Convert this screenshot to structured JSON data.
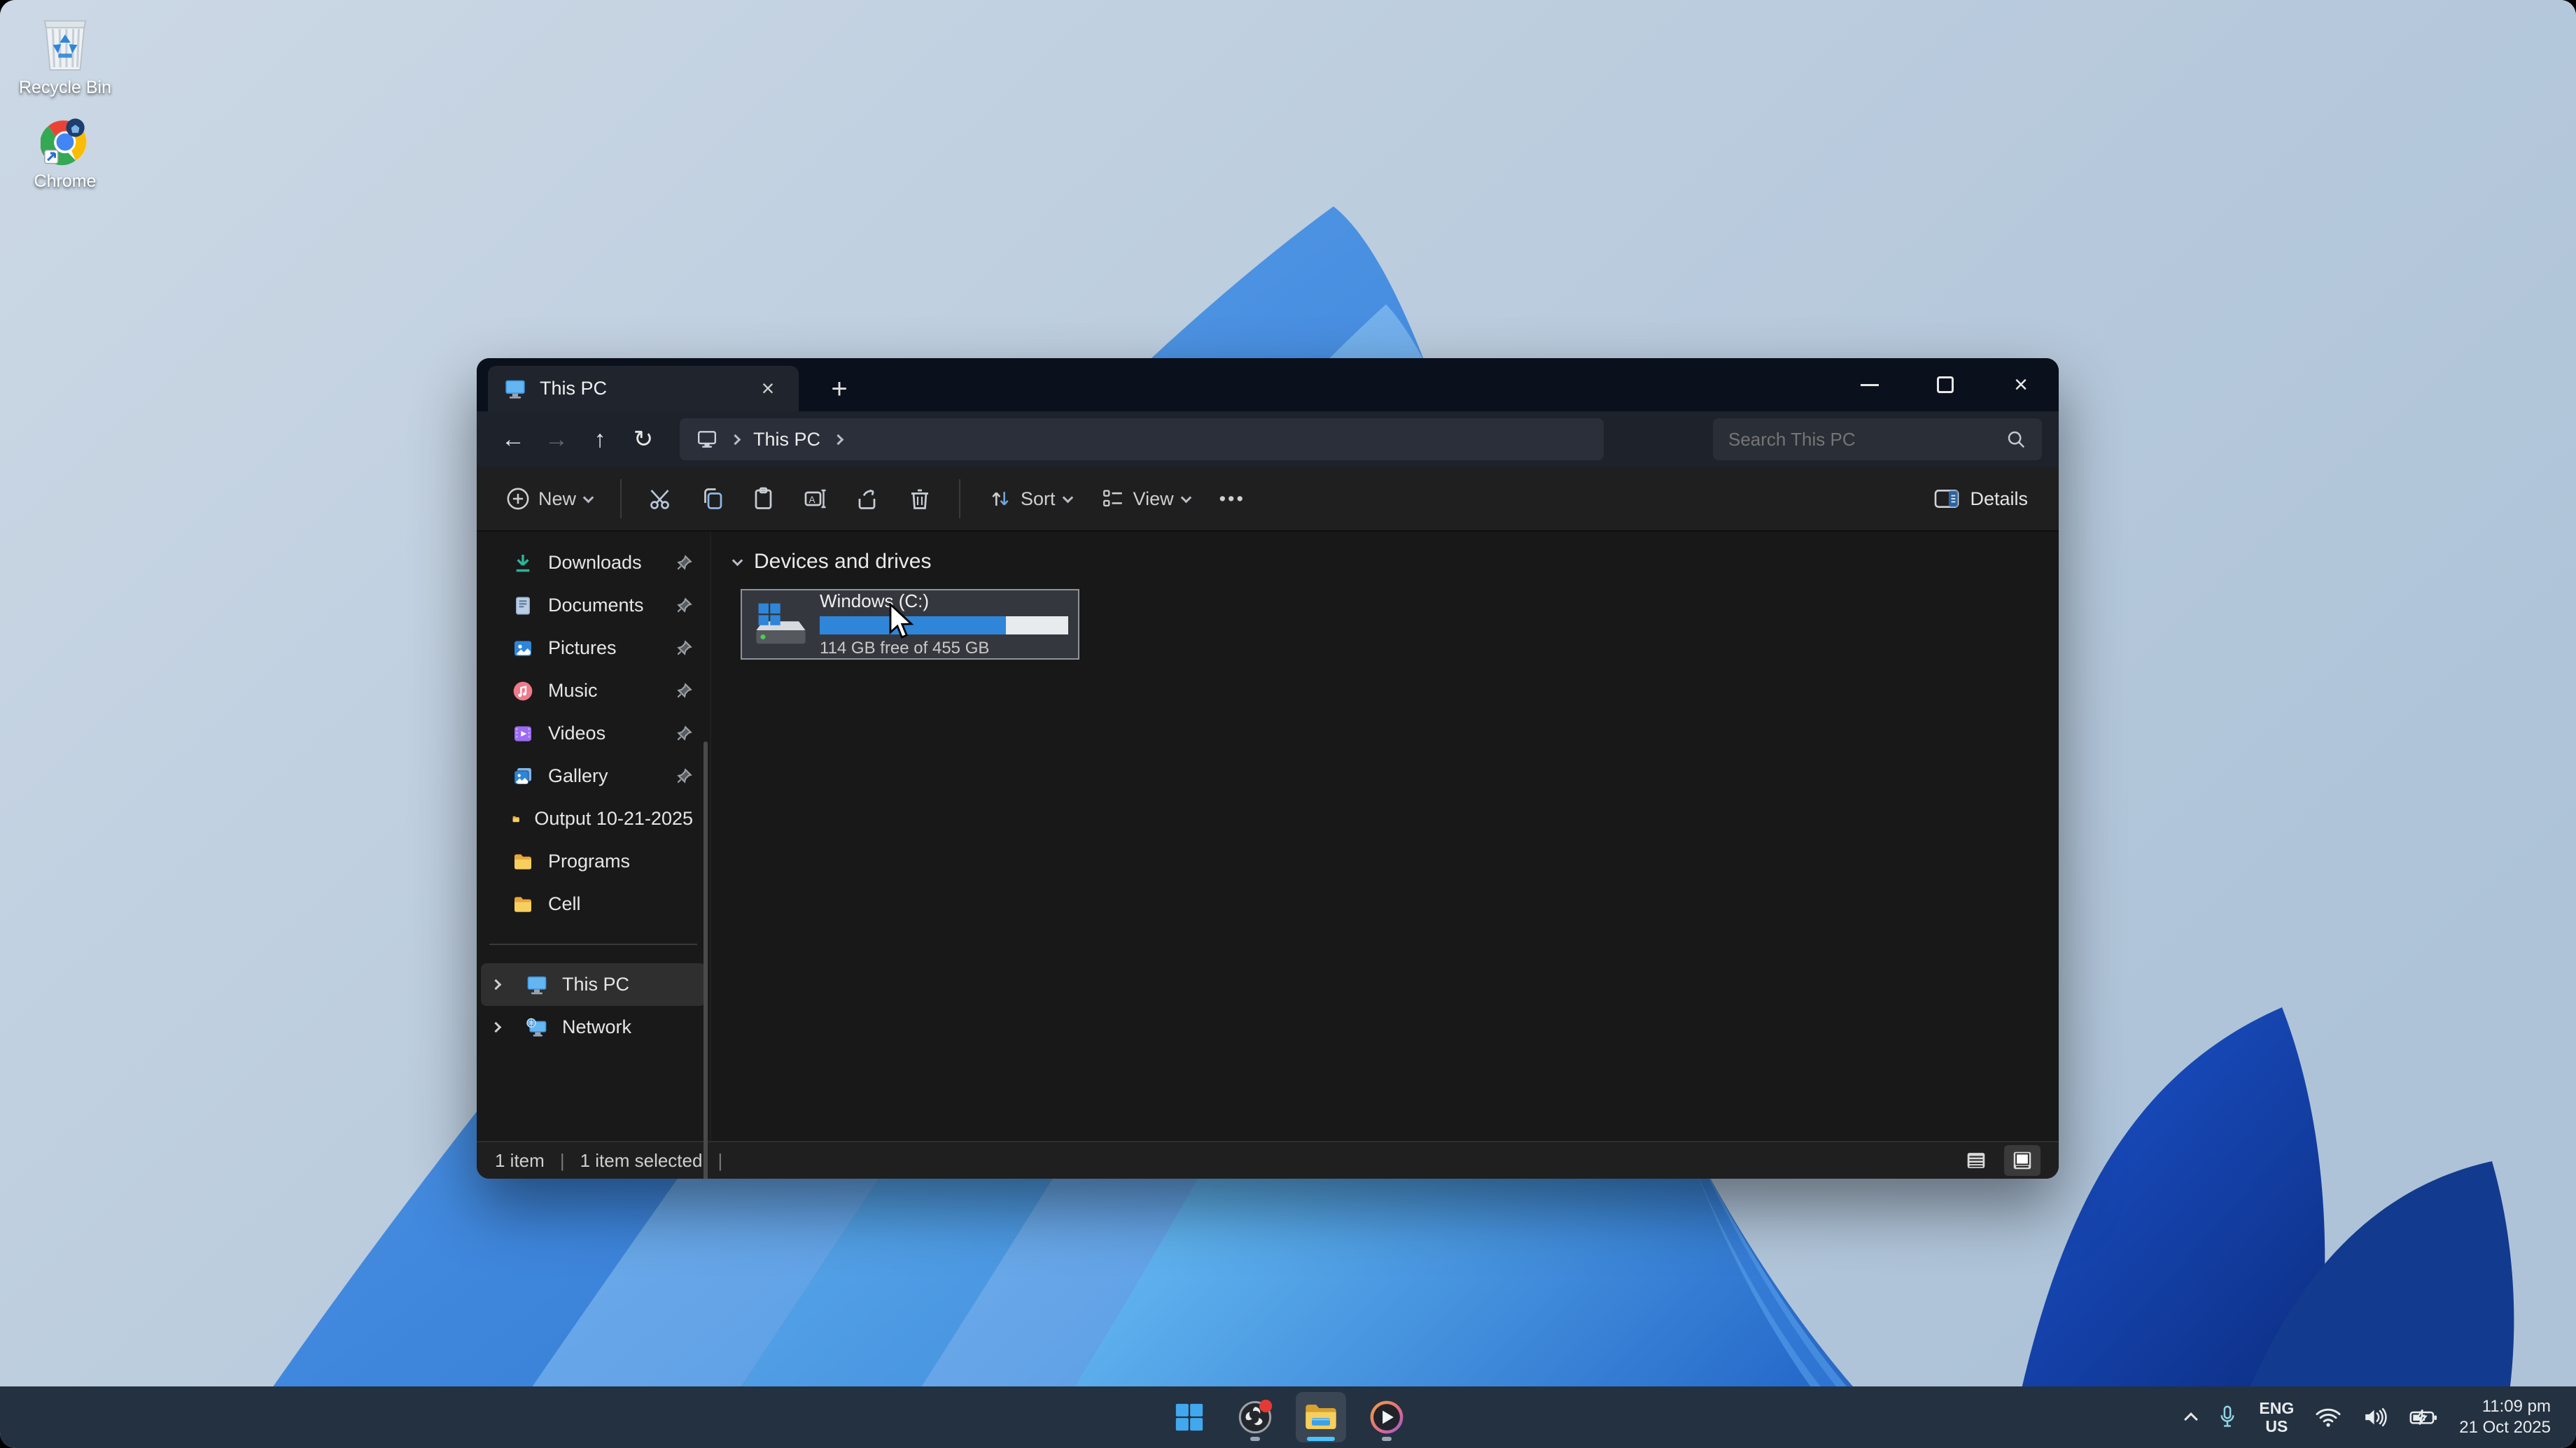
{
  "desktop": {
    "icons": [
      {
        "label": "Recycle Bin"
      },
      {
        "label": "Chrome"
      }
    ]
  },
  "window": {
    "tab_title": "This PC",
    "icons": {
      "tab_close": "×",
      "new_tab": "+",
      "back": "←",
      "forward": "→",
      "up": "↑",
      "refresh": "↻",
      "window_close": "×",
      "more": "•••"
    },
    "breadcrumb": {
      "root": "This PC"
    },
    "search": {
      "placeholder": "Search This PC"
    },
    "toolbar": {
      "new_label": "New",
      "sort_label": "Sort",
      "view_label": "View",
      "details_label": "Details"
    },
    "sidebar": {
      "items": [
        {
          "label": "Downloads",
          "pinned": true
        },
        {
          "label": "Documents",
          "pinned": true
        },
        {
          "label": "Pictures",
          "pinned": true
        },
        {
          "label": "Music",
          "pinned": true
        },
        {
          "label": "Videos",
          "pinned": true
        },
        {
          "label": "Gallery",
          "pinned": true
        },
        {
          "label": "Output 10-21-2025",
          "pinned": false
        },
        {
          "label": "Programs",
          "pinned": false
        },
        {
          "label": "Cell",
          "pinned": false
        }
      ],
      "tree": [
        {
          "label": "This PC",
          "selected": true
        },
        {
          "label": "Network",
          "selected": false
        }
      ]
    },
    "content": {
      "group_header": "Devices and drives",
      "drives": [
        {
          "name": "Windows (C:)",
          "free_text": "114 GB free of 455 GB",
          "used_percent": 75
        }
      ]
    },
    "statusbar": {
      "items_count": "1 item",
      "selected_count": "1 item selected",
      "divider": "|"
    },
    "accent_color": "#2f86d8"
  },
  "taskbar": {
    "tray": {
      "lang_line1": "ENG",
      "lang_line2": "US",
      "time": "11:09 pm",
      "date": "21 Oct 2025"
    }
  }
}
